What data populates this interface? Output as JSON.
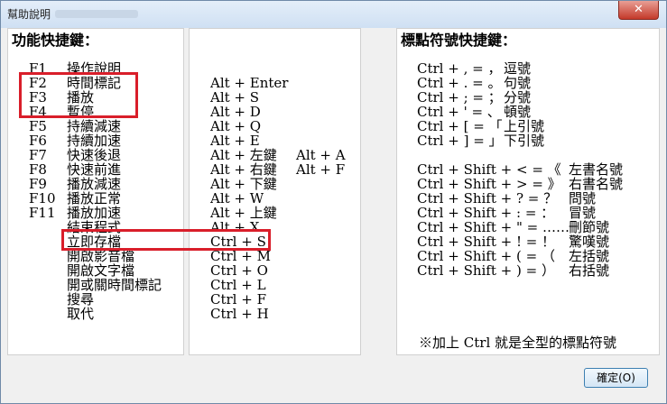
{
  "window": {
    "title": "幫助說明",
    "close_label": "✕"
  },
  "left": {
    "heading": "功能快捷鍵：",
    "keys": [
      "F1",
      "F2",
      "F3",
      "F4",
      "F5",
      "F6",
      "F7",
      "F8",
      "F9",
      "F10",
      "F11"
    ],
    "functions": [
      "操作說明",
      "時間標記",
      "播放",
      "暫停",
      "持續減速",
      "持續加速",
      "快速後退",
      "快速前進",
      "播放減速",
      "播放正常",
      "播放加速",
      "結束程式",
      "立即存檔",
      "開啟影音檔",
      "開啟文字檔",
      "開或關時間標記",
      "搜尋",
      "取代"
    ]
  },
  "middle": {
    "shortcuts": [
      "Alt + Enter",
      "Alt + S",
      "Alt + D",
      "Alt + Q",
      "Alt + E",
      "Alt + 左鍵",
      "Alt + 右鍵",
      "Alt + 下鍵",
      "Alt + W",
      "Alt + 上鍵",
      "Alt + X",
      "Ctrl + S",
      "Ctrl + M",
      "Ctrl + O",
      "Ctrl + L",
      "Ctrl + F",
      "Ctrl + H"
    ],
    "alt_shortcuts": [
      "Alt + A",
      "Alt + F"
    ]
  },
  "right": {
    "heading": "標點符號快捷鍵：",
    "group1": [
      {
        "key": "Ctrl + , = ，",
        "name": "逗號"
      },
      {
        "key": "Ctrl + . = 。",
        "name": "句號"
      },
      {
        "key": "Ctrl + ; = ；",
        "name": "分號"
      },
      {
        "key": "Ctrl + ' = 、",
        "name": "頓號"
      },
      {
        "key": "Ctrl + [ = 「",
        "name": "上引號"
      },
      {
        "key": "Ctrl + ] = 」",
        "name": "下引號"
      }
    ],
    "group2": [
      {
        "key": "Ctrl + Shift + < = 《",
        "name": "左書名號"
      },
      {
        "key": "Ctrl + Shift + > = 》",
        "name": "右書名號"
      },
      {
        "key": "Ctrl + Shift + ? = ？",
        "name": "問號"
      },
      {
        "key": "Ctrl + Shift + : = ：",
        "name": "冒號"
      },
      {
        "key": "Ctrl + Shift + \" = ……",
        "name": "刪節號"
      },
      {
        "key": "Ctrl + Shift + ! = ！",
        "name": "驚嘆號"
      },
      {
        "key": "Ctrl + Shift + ( = （",
        "name": "左括號"
      },
      {
        "key": "Ctrl + Shift + ) = ）",
        "name": "右括號"
      }
    ],
    "note": "※加上 Ctrl 就是全型的標點符號"
  },
  "ok_label": "確定(O)"
}
